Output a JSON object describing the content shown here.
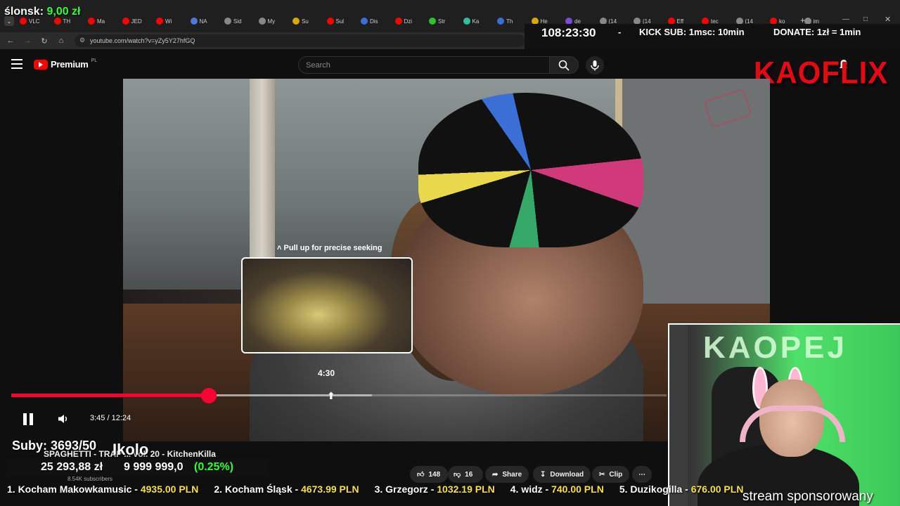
{
  "browser": {
    "tabs": [
      {
        "label": "VLC",
        "color": "#ff0000"
      },
      {
        "label": "TH",
        "color": "#ff0000"
      },
      {
        "label": "Ma",
        "color": "#ff0000"
      },
      {
        "label": "JED",
        "color": "#ff0000"
      },
      {
        "label": "Wi",
        "color": "#ff0000"
      },
      {
        "label": "NA",
        "color": "#4a7bd8"
      },
      {
        "label": "Sid",
        "color": "#888888"
      },
      {
        "label": "My",
        "color": "#888888"
      },
      {
        "label": "Su",
        "color": "#d8a800"
      },
      {
        "label": "Sul",
        "color": "#ff0000"
      },
      {
        "label": "Dis",
        "color": "#3b6fd6"
      },
      {
        "label": "Dzi",
        "color": "#ff0000"
      },
      {
        "label": "Str",
        "color": "#30c030"
      },
      {
        "label": "Ka",
        "color": "#30c0a0"
      },
      {
        "label": "Th",
        "color": "#3b6fd6"
      },
      {
        "label": "He",
        "color": "#d8a800"
      },
      {
        "label": "de",
        "color": "#7a4bd8"
      },
      {
        "label": "(14",
        "color": "#888888"
      },
      {
        "label": "(14",
        "color": "#888888"
      },
      {
        "label": "Eff",
        "color": "#ff0000"
      },
      {
        "label": "tec",
        "color": "#ff0000"
      },
      {
        "label": "(14",
        "color": "#888888"
      },
      {
        "label": "ko",
        "color": "#ff0000"
      },
      {
        "label": "im",
        "color": "#888888"
      }
    ],
    "new_tab": "+",
    "url": "youtube.com/watch?v=yZy5Y27hfGQ"
  },
  "youtube": {
    "logo_text": "Premium",
    "logo_region": "PL",
    "search_placeholder": "Search"
  },
  "player": {
    "seek_hint": "Pull up for precise seeking",
    "hover_time": "4:30",
    "current_time": "3:45",
    "duration": "12:24",
    "time_display": "3:45 / 12:24",
    "progress_fraction": 0.302,
    "buffered_fraction": 0.55,
    "accent": "#ff0033"
  },
  "video_info": {
    "title": "SPAGHETTI - TRAP ... vol. 20 - KitchenKilla",
    "subscribers": "8.54K subscribers",
    "likes": "148",
    "dislikes": "16",
    "share_label": "Share",
    "download_label": "Download",
    "clip_label": "Clip",
    "more_icon": "more-horizontal-icon"
  },
  "overlay": {
    "top_donor_name": "ślonsk:",
    "top_donor_amount": "9,00 zł",
    "timer": "108:23:30",
    "timer_sep": "-",
    "kick_sub": "KICK SUB: 1msc: 10min",
    "donate": "DONATE: 1zł = 1min",
    "brand": "KAOFLIX",
    "suby": "Suby: 3693/50",
    "ikolo": "Ikolo",
    "goal_current": "25 293,88 zł",
    "goal_target": "9 999 999,0",
    "goal_percent": "(0.25%)",
    "ticker": [
      {
        "rank": "1. Kocham Makowkamusic -",
        "amount": "4935.00 PLN"
      },
      {
        "rank": "2. Kocham Śląsk -",
        "amount": "4673.99 PLN"
      },
      {
        "rank": "3. Grzegorz -",
        "amount": "1032.19 PLN"
      },
      {
        "rank": "4. widz -",
        "amount": "740.00 PLN"
      },
      {
        "rank": "5. Duzikogilla -",
        "amount": "676.00 PLN"
      }
    ],
    "sponsor": "stream sponsorowany",
    "webcam_sign": "KAOPEJ",
    "donor_color": "#30ff30",
    "ticker_amount_color": "#f5e23a"
  }
}
